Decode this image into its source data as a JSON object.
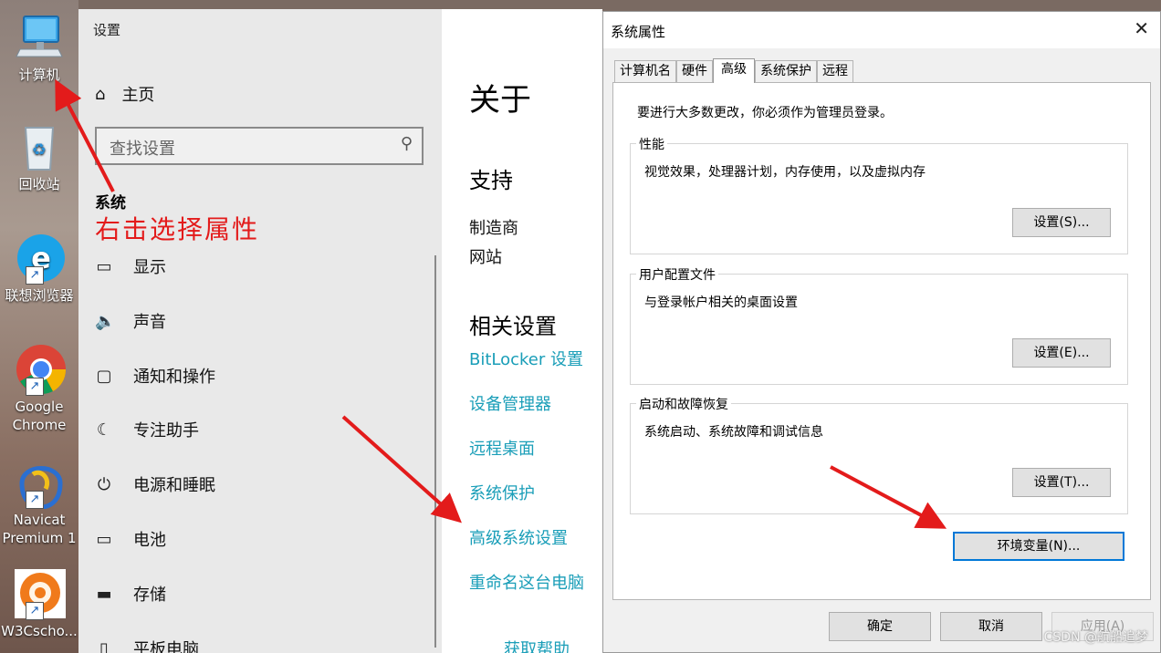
{
  "desktop": {
    "icons": [
      {
        "label": "计算机"
      },
      {
        "label": "回收站"
      },
      {
        "label": "联想浏览器"
      },
      {
        "label_line1": "Google",
        "label_line2": "Chrome"
      },
      {
        "label_line1": "Navicat",
        "label_line2": "Premium 1"
      },
      {
        "label": "W3Cscho..."
      }
    ]
  },
  "settings": {
    "title": "设置",
    "home": "主页",
    "search_placeholder": "查找设置",
    "section": "系统",
    "annotation": "右击选择属性",
    "nav": [
      {
        "label": "显示"
      },
      {
        "label": "声音"
      },
      {
        "label": "通知和操作"
      },
      {
        "label": "专注助手"
      },
      {
        "label": "电源和睡眠"
      },
      {
        "label": "电池"
      },
      {
        "label": "存储"
      },
      {
        "label": "平板电脑"
      }
    ]
  },
  "about": {
    "title": "关于",
    "support_heading": "支持",
    "manufacturer": "制造商",
    "website": "网站",
    "related_heading": "相关设置",
    "links": [
      "BitLocker 设置",
      "设备管理器",
      "远程桌面",
      "系统保护",
      "高级系统设置",
      "重命名这台电脑"
    ],
    "help": "获取帮助"
  },
  "dialog": {
    "title": "系统属性",
    "tabs": [
      "计算机名",
      "硬件",
      "高级",
      "系统保护",
      "远程"
    ],
    "admin_note": "要进行大多数更改，你必须作为管理员登录。",
    "groups": [
      {
        "label": "性能",
        "desc": "视觉效果，处理器计划，内存使用，以及虚拟内存",
        "button": "设置(S)..."
      },
      {
        "label": "用户配置文件",
        "desc": "与登录帐户相关的桌面设置",
        "button": "设置(E)..."
      },
      {
        "label": "启动和故障恢复",
        "desc": "系统启动、系统故障和调试信息",
        "button": "设置(T)..."
      }
    ],
    "env_button": "环境变量(N)...",
    "ok": "确定",
    "cancel": "取消",
    "apply": "应用(A)"
  },
  "watermark": "CSDN @航船追梦",
  "colors": {
    "annotation": "#e31b1b",
    "link": "#1a9eb8",
    "focus": "#0078d7"
  }
}
